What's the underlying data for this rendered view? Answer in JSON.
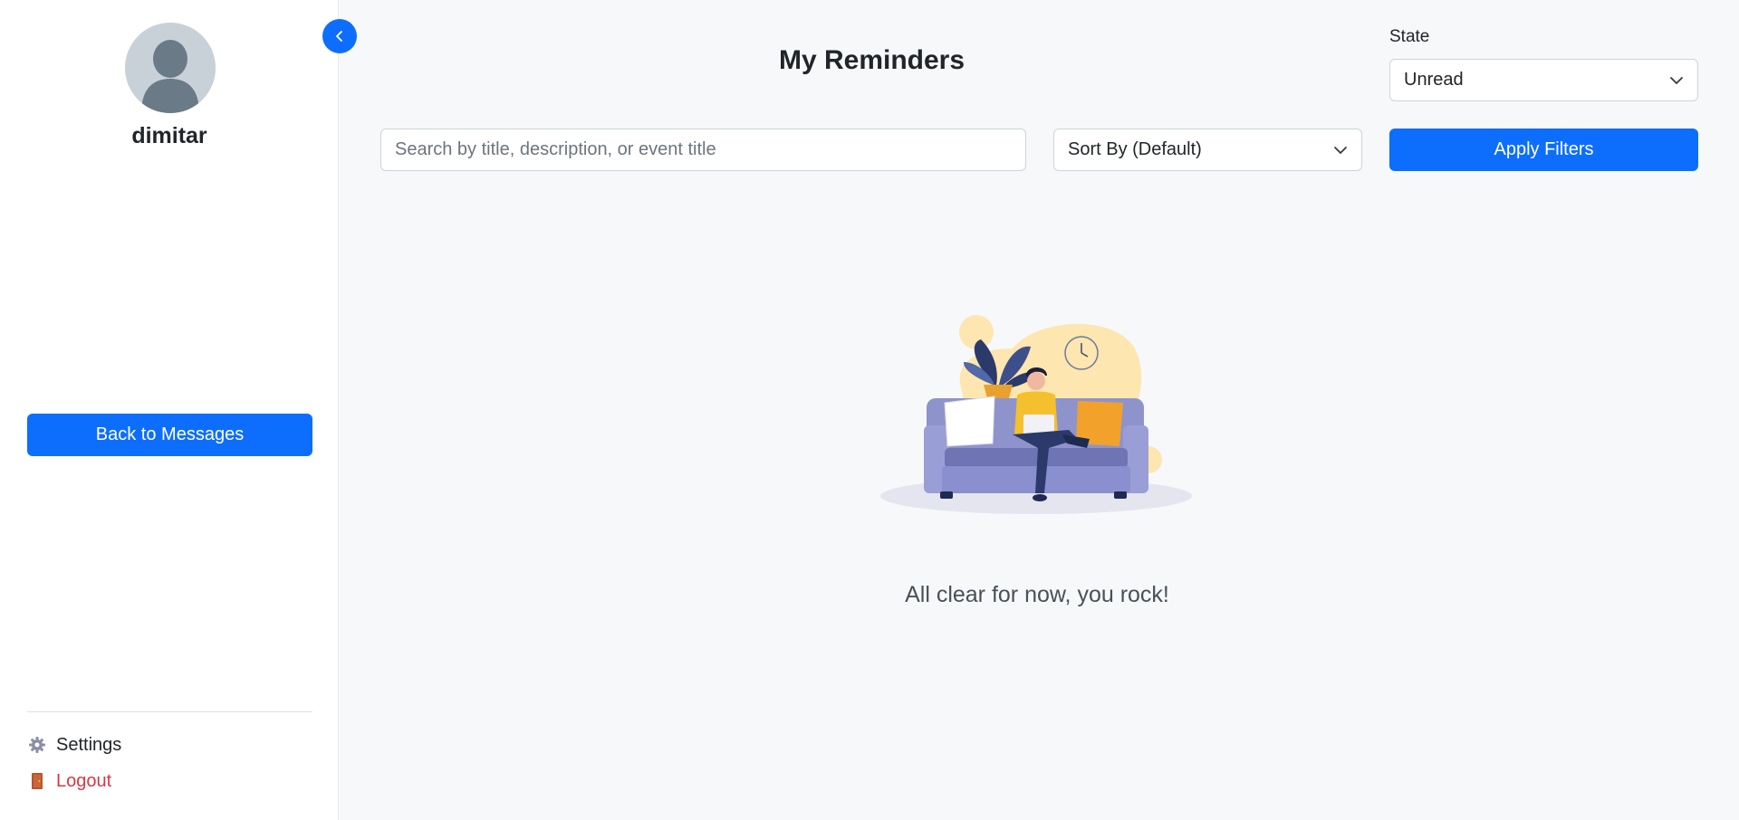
{
  "sidebar": {
    "username": "dimitar",
    "back_label": "Back to Messages",
    "settings_label": "Settings",
    "logout_label": "Logout",
    "settings_icon": "gear-icon",
    "logout_icon": "door-icon"
  },
  "header": {
    "title": "My Reminders"
  },
  "filters": {
    "state_label": "State",
    "state_value": "Unread",
    "search_placeholder": "Search by title, description, or event title",
    "sort_value": "Sort By (Default)",
    "apply_label": "Apply Filters"
  },
  "empty_state": {
    "message": "All clear for now, you rock!"
  },
  "colors": {
    "primary": "#0d6efd",
    "danger": "#dc3545",
    "background": "#f7f8fa"
  }
}
